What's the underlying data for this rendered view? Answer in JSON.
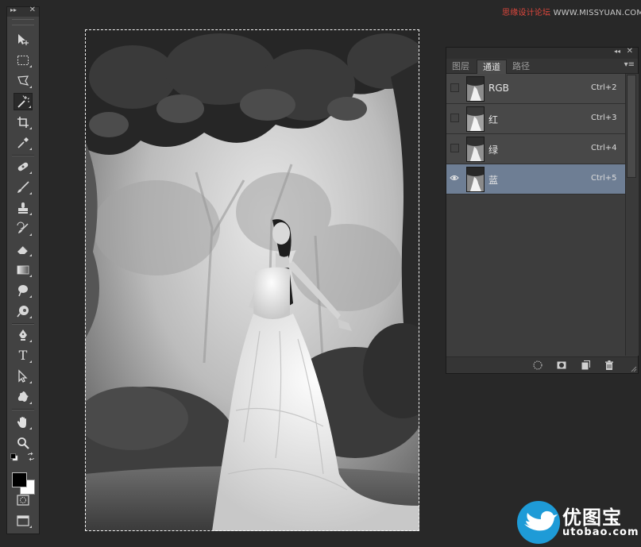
{
  "watermark": {
    "top_cn": "思缘设计论坛",
    "top_url": "WWW.MISSYUAN.COM",
    "logo_cn": "优图宝",
    "logo_url": "utobao.com"
  },
  "toolbar": {
    "tools": [
      "move-tool",
      "marquee-tool",
      "lasso-tool",
      "magic-wand-tool",
      "crop-tool",
      "eyedropper-tool",
      "healing-brush-tool",
      "brush-tool",
      "clone-stamp-tool",
      "history-brush-tool",
      "eraser-tool",
      "gradient-tool",
      "blur-tool",
      "dodge-tool",
      "pen-tool",
      "type-tool",
      "path-selection-tool",
      "shape-tool",
      "hand-tool",
      "zoom-tool"
    ],
    "active_tool": "magic-wand-tool",
    "foreground_color": "#000000",
    "background_color": "#ffffff",
    "type_glyph": "T"
  },
  "channels_panel": {
    "tabs": [
      {
        "label": "图层",
        "active": false
      },
      {
        "label": "通道",
        "active": true
      },
      {
        "label": "路径",
        "active": false
      }
    ],
    "channels": [
      {
        "name": "RGB",
        "shortcut": "Ctrl+2",
        "visible": false,
        "selected": false
      },
      {
        "name": "红",
        "shortcut": "Ctrl+3",
        "visible": false,
        "selected": false
      },
      {
        "name": "绿",
        "shortcut": "Ctrl+4",
        "visible": false,
        "selected": false
      },
      {
        "name": "蓝",
        "shortcut": "Ctrl+5",
        "visible": true,
        "selected": true
      }
    ],
    "footer_icons": [
      "load-selection-icon",
      "save-selection-icon",
      "new-channel-icon",
      "delete-channel-icon"
    ]
  },
  "colors": {
    "app_background": "#282828",
    "panel_background": "#3d3d3d",
    "selected_row": "#6e7e94",
    "watermark_red": "#e0473d"
  }
}
